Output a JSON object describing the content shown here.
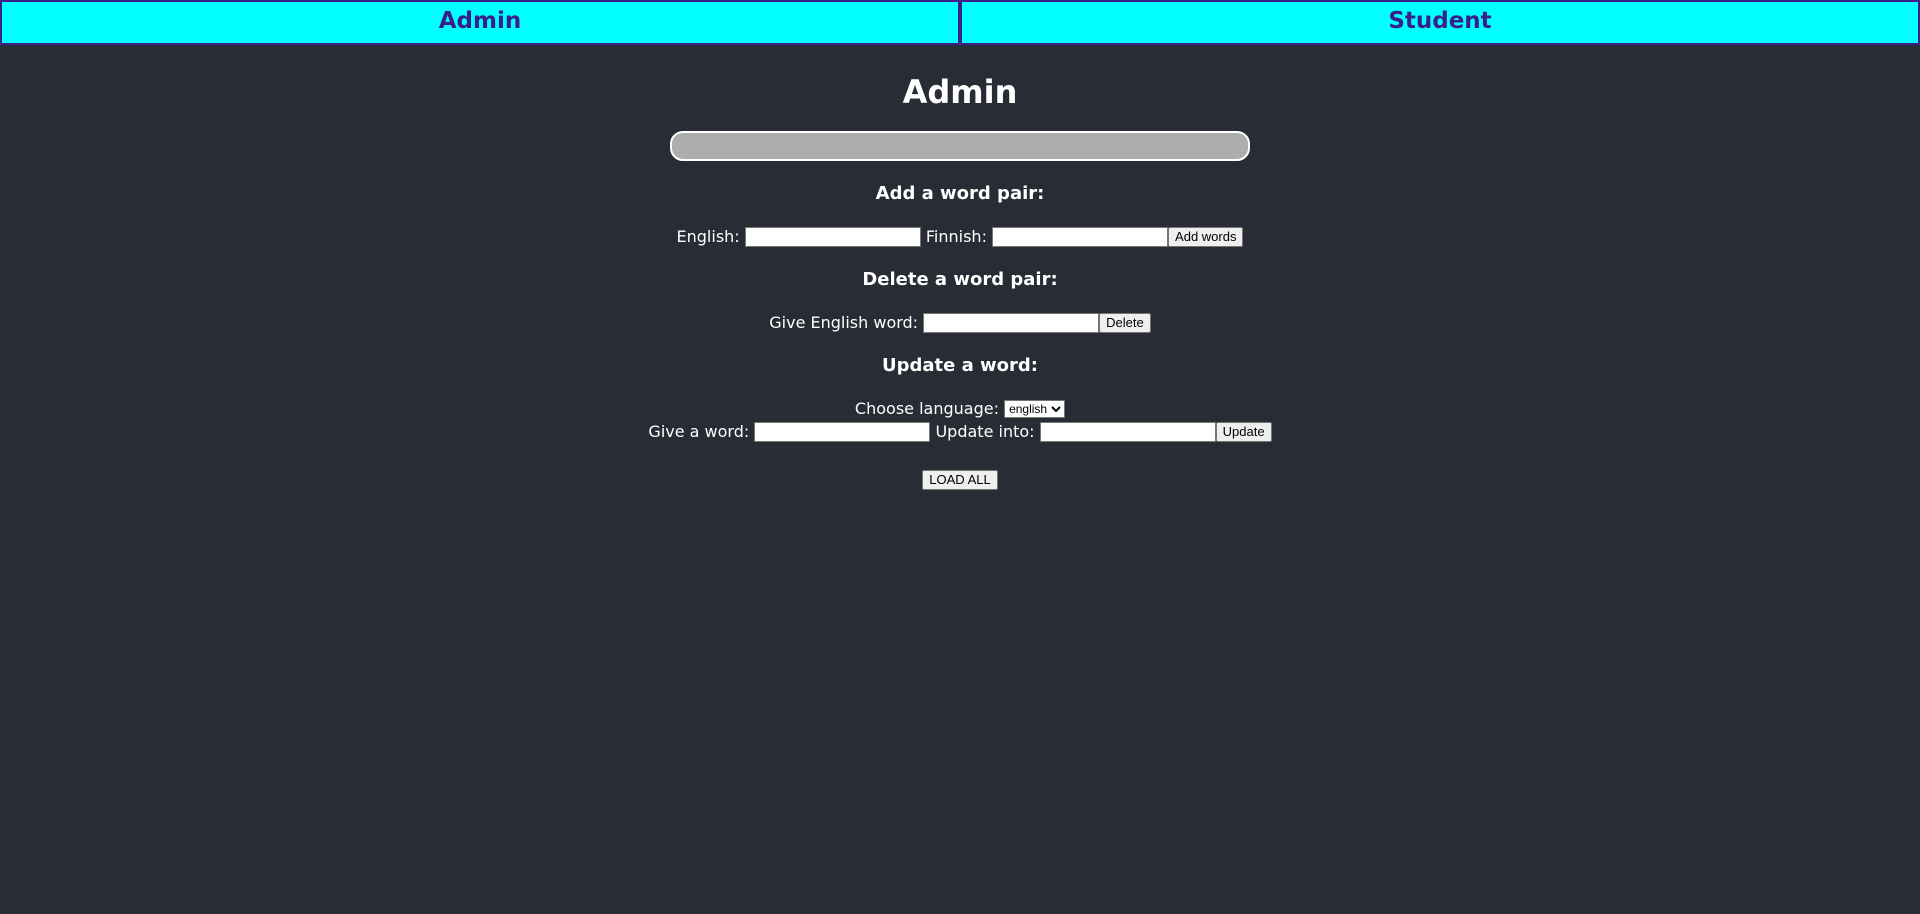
{
  "nav": {
    "tabs": [
      {
        "label": "Admin"
      },
      {
        "label": "Student"
      }
    ]
  },
  "page": {
    "title": "Admin"
  },
  "add_section": {
    "heading": "Add a word pair:",
    "english_label": "English:",
    "finnish_label": "Finnish:",
    "english_value": "",
    "finnish_value": "",
    "button_label": "Add words"
  },
  "delete_section": {
    "heading": "Delete a word pair:",
    "label": "Give English word:",
    "value": "",
    "button_label": "Delete"
  },
  "update_section": {
    "heading": "Update a word:",
    "language_label": "Choose language:",
    "language_selected": "english",
    "word_label": "Give a word:",
    "into_label": "Update into:",
    "word_value": "",
    "into_value": "",
    "button_label": "Update"
  },
  "load_all": {
    "button_label": "LOAD ALL"
  },
  "colors": {
    "background": "#282c34",
    "nav_background": "#00ffff",
    "nav_text": "#3a1f8c",
    "message_bar": "#adadad"
  }
}
